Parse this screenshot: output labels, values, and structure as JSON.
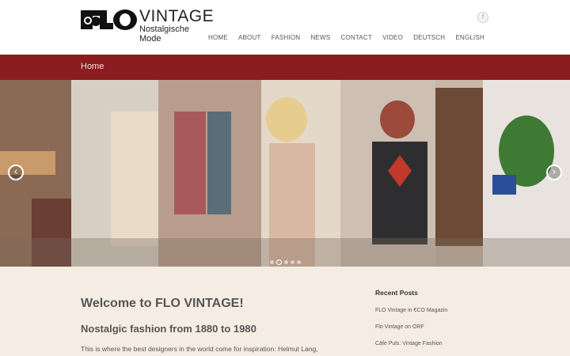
{
  "logo": {
    "mark": "FLO",
    "name": "VINTAGE",
    "tagline": "Nostalgische Mode"
  },
  "social": {
    "facebook_glyph": "f",
    "icon": "facebook-icon"
  },
  "nav": {
    "items": [
      {
        "label": "HOME"
      },
      {
        "label": "ABOUT"
      },
      {
        "label": "FASHION"
      },
      {
        "label": "NEWS"
      },
      {
        "label": "CONTACT"
      },
      {
        "label": "VIDEO"
      },
      {
        "label": "DEUTSCH"
      },
      {
        "label": "ENGLISH"
      }
    ]
  },
  "page_title": "Home",
  "slider": {
    "prev_glyph": "‹",
    "next_glyph": "›",
    "slide_count": 5,
    "active_slide": 2
  },
  "main": {
    "heading": "Welcome to FLO VINTAGE!",
    "subheading": "Nostalgic fashion from 1880 to 1980",
    "intro": "This is where the best designers in the world come for inspiration: Helmut Lang,"
  },
  "sidebar": {
    "title": "Recent Posts",
    "posts": [
      {
        "label": "FLO Vintage in €CO Magazin"
      },
      {
        "label": "Flo Vintage on ORF"
      },
      {
        "label": "Cäfe Puls: Vintage Fashion"
      }
    ]
  },
  "colors": {
    "titlebar": "#8b1c1f",
    "background": "#f5ede4",
    "header": "#ffffff"
  }
}
